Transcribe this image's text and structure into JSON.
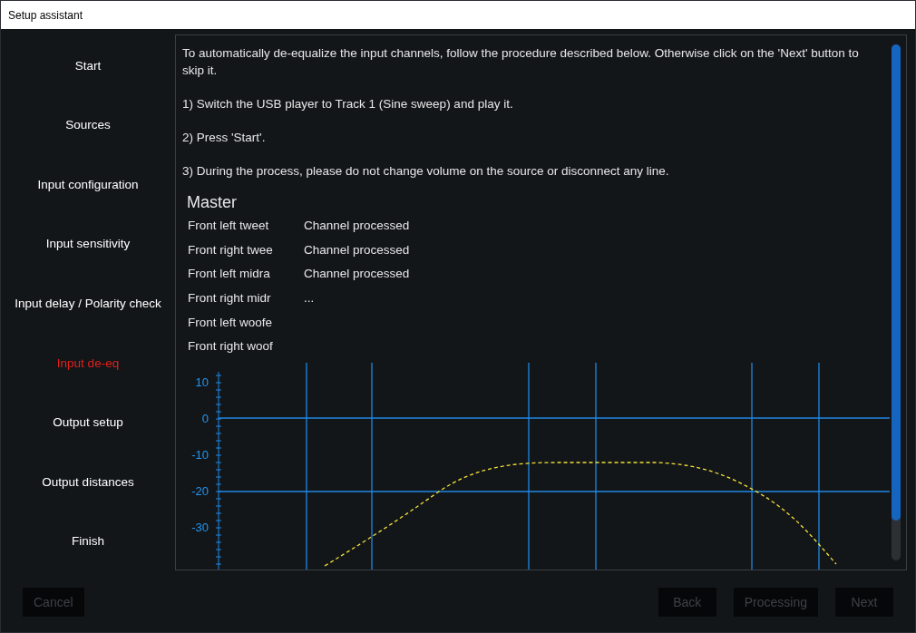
{
  "window": {
    "title": "Setup assistant"
  },
  "sidebar": {
    "items": [
      {
        "label": "Start",
        "selected": false
      },
      {
        "label": "Sources",
        "selected": false
      },
      {
        "label": "Input configuration",
        "selected": false
      },
      {
        "label": "Input sensitivity",
        "selected": false
      },
      {
        "label": "Input delay / Polarity check",
        "selected": false
      },
      {
        "label": "Input de-eq",
        "selected": true
      },
      {
        "label": "Output setup",
        "selected": false
      },
      {
        "label": "Output distances",
        "selected": false
      },
      {
        "label": "Finish",
        "selected": false
      }
    ]
  },
  "instructions": [
    "To automatically de-equalize the input channels, follow the procedure described below. Otherwise click on the 'Next' button to skip it.",
    "1) Switch the USB player to Track 1 (Sine sweep) and play it.",
    "2) Press 'Start'.",
    "3) During the process, please do not change volume on the source or disconnect any line."
  ],
  "group_title": "Master",
  "channels": [
    {
      "name": "Front left tweet",
      "status": "Channel processed"
    },
    {
      "name": "Front right twee",
      "status": "Channel processed"
    },
    {
      "name": "Front left midra",
      "status": "Channel processed"
    },
    {
      "name": "Front right midr",
      "status": "..."
    },
    {
      "name": "Front left woofe"
    },
    {
      "name": "Front right woof"
    }
  ],
  "graph": {
    "y_ticks": [
      "10",
      "0",
      "-10",
      "-20",
      "-30"
    ]
  },
  "left_buttons": [
    {
      "label": "Cancel",
      "disabled": true
    }
  ],
  "right_buttons": [
    {
      "label": "Back",
      "disabled": true
    },
    {
      "label": "Processing",
      "disabled": true
    },
    {
      "label": "Next",
      "disabled": true
    }
  ]
}
